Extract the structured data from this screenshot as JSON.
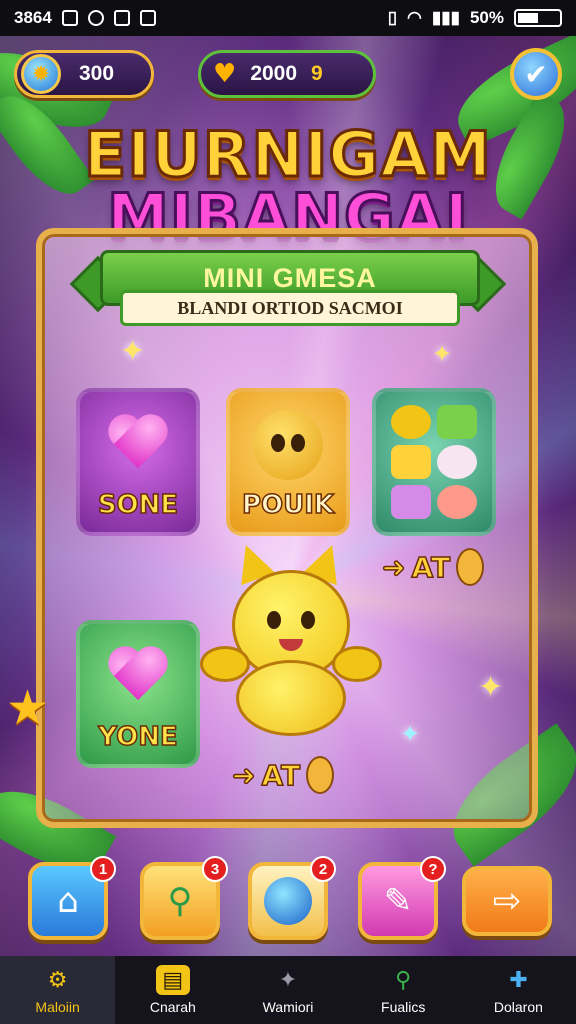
{
  "status_bar": {
    "time": "3864",
    "battery": "50%"
  },
  "top_bar": {
    "coins": "300",
    "gems": "2000",
    "gems_suffix": "9"
  },
  "title": {
    "line1": "EIURNIGAM",
    "line2": "MIBANGAI"
  },
  "ribbon": {
    "label": "MINI GMESA",
    "subtitle": "BLANDI ORTIOD SACMOI"
  },
  "tiles": [
    {
      "label": "SONE"
    },
    {
      "label": "POUIK"
    },
    {
      "label": "YONE"
    }
  ],
  "side_labels": {
    "right_arrow": "AT",
    "bottom_arrow": "AT"
  },
  "actions": [
    {
      "icon": "home-icon",
      "badge": "1"
    },
    {
      "icon": "magnifier-icon",
      "badge": "3"
    },
    {
      "icon": "orb-icon",
      "badge": "2"
    },
    {
      "icon": "pencil-icon",
      "badge": "?"
    },
    {
      "icon": "arrow-right-icon",
      "badge": ""
    }
  ],
  "nav": [
    {
      "label": "Maloiin",
      "icon": "gear-icon"
    },
    {
      "label": "Cnarah",
      "icon": "shop-icon"
    },
    {
      "label": "Wamiori",
      "icon": "star-shape-icon"
    },
    {
      "label": "Fualics",
      "icon": "search-icon"
    },
    {
      "label": "Dolaron",
      "icon": "puzzle-icon"
    }
  ],
  "colors": {
    "gold": "#f2b73a",
    "pink": "#ff4fd8",
    "green": "#3d9a28",
    "bg_dark": "#2b1244"
  }
}
